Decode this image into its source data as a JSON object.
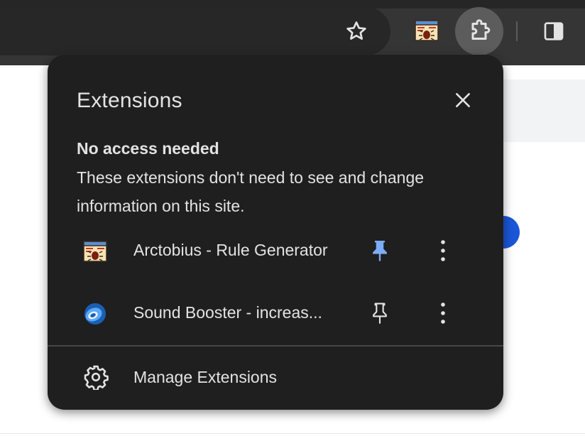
{
  "toolbar": {
    "bookmark_icon": "star-icon",
    "extensions_icon": "puzzle-icon",
    "side_panel_icon": "side-panel-icon"
  },
  "popup": {
    "title": "Extensions",
    "close_icon": "close-icon",
    "section": {
      "heading": "No access needed",
      "description": "These extensions don't need to see and change information on this site."
    },
    "extensions": [
      {
        "name": "Arctobius - Rule Generator",
        "icon": "arctobius-icon",
        "pinned": true
      },
      {
        "name": "Sound Booster - increas...",
        "icon": "sound-booster-icon",
        "pinned": false
      }
    ],
    "manage_label": "Manage Extensions",
    "manage_icon": "gear-icon"
  },
  "colors": {
    "popup_bg": "#1f1f1f",
    "toolbar_bg": "#353535",
    "text": "#e3e3e3",
    "pin_active": "#7cacf8",
    "puzzle_button_bg": "#5c5c5c"
  }
}
